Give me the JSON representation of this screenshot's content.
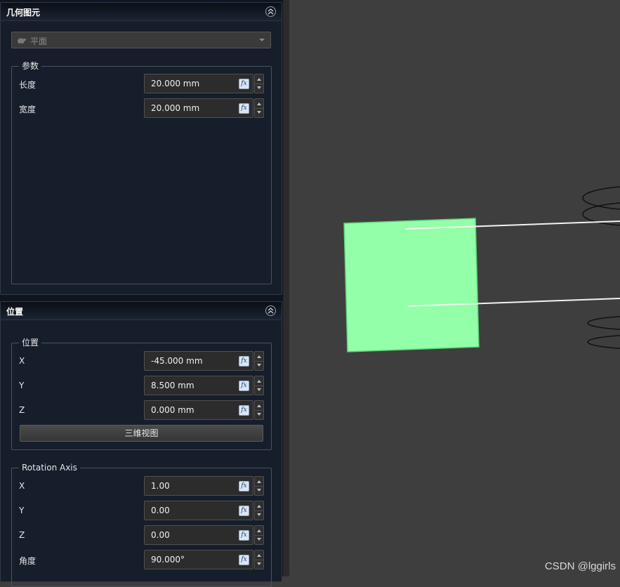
{
  "geometry_panel": {
    "title": "几何图元",
    "primitive_select": {
      "value": "平面",
      "icon": "turtle-icon"
    },
    "params_group": {
      "title": "参数",
      "fields": [
        {
          "label": "长度",
          "value": "20.000 mm"
        },
        {
          "label": "宽度",
          "value": "20.000 mm"
        }
      ]
    }
  },
  "position_panel": {
    "title": "位置",
    "position_group": {
      "title": "位置",
      "fields": [
        {
          "label": "X",
          "value": "-45.000 mm"
        },
        {
          "label": "Y",
          "value": "8.500 mm"
        },
        {
          "label": "Z",
          "value": "0.000 mm"
        }
      ],
      "button_label": "三维视图"
    },
    "rotation_group": {
      "title": "Rotation Axis",
      "fields": [
        {
          "label": "X",
          "value": "1.00"
        },
        {
          "label": "Y",
          "value": "0.00"
        },
        {
          "label": "Z",
          "value": "0.00"
        },
        {
          "label": "角度",
          "value": "90.000°"
        }
      ]
    }
  },
  "fx_label": "fx",
  "watermark": "CSDN @lggirls",
  "colors": {
    "plane_fill": "#93ffa8",
    "viewport_bg": "#3e3e3e",
    "panel_bg": "#161d2b"
  }
}
